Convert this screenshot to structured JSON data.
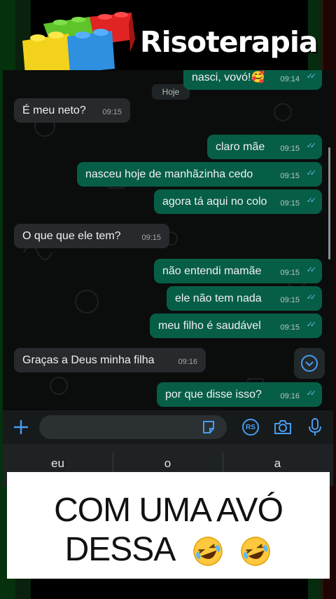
{
  "brand": {
    "name": "Risoterapia"
  },
  "chat": {
    "date_chip": "Hoje",
    "messages": [
      {
        "dir": "out",
        "text": "nasci, vovó!",
        "emoji": "🥰",
        "time": "09:14",
        "partial": true
      },
      {
        "dir": "in",
        "text": "É meu neto?",
        "time": "09:15"
      },
      {
        "dir": "out",
        "text": "claro mãe",
        "time": "09:15"
      },
      {
        "dir": "out",
        "text": "nasceu hoje de manhãzinha cedo",
        "time": "09:15"
      },
      {
        "dir": "out",
        "text": "agora tá aqui no colo",
        "time": "09:15"
      },
      {
        "dir": "in",
        "text": "O que que ele tem?",
        "time": "09:15"
      },
      {
        "dir": "out",
        "text": "não entendi mamãe",
        "time": "09:15"
      },
      {
        "dir": "out",
        "text": "ele não tem nada",
        "time": "09:15"
      },
      {
        "dir": "out",
        "text": "meu filho é saudável",
        "time": "09:15"
      },
      {
        "dir": "in",
        "text": "Graças a Deus minha filha",
        "time": "09:16"
      },
      {
        "dir": "out",
        "text": "por que disse isso?",
        "time": "09:16"
      }
    ]
  },
  "input_bar": {
    "icons": [
      "plus-icon",
      "sticker-icon",
      "rs-payment-icon",
      "camera-icon",
      "microphone-icon"
    ],
    "rs_label": "RS"
  },
  "keyboard": {
    "suggestions": [
      "eu",
      "o",
      "a"
    ]
  },
  "caption": {
    "line1": "COM UMA AVÓ",
    "line2": "DESSA"
  },
  "colors": {
    "outgoing": "#075e47",
    "incoming": "#262a2c",
    "ticks": "#53bdeb",
    "accent": "#4a9cf0"
  }
}
